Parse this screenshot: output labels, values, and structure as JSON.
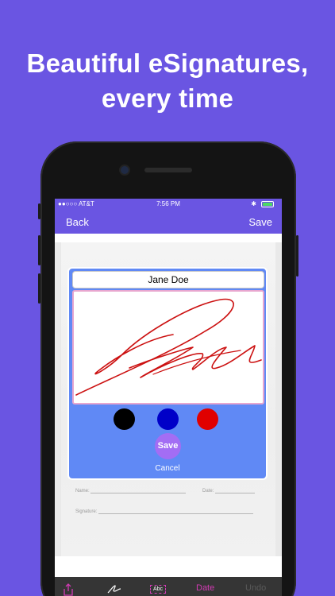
{
  "headline": {
    "line1": "Beautiful eSignatures,",
    "line2": "every time"
  },
  "status_bar": {
    "carrier": "●●○○○ AT&T",
    "time": "7:56 PM",
    "bluetooth": "✱"
  },
  "nav": {
    "back_label": "Back",
    "save_label": "Save"
  },
  "document": {
    "name_label": "Name:",
    "date_label": "Date:",
    "signature_label": "Signature:"
  },
  "signature_panel": {
    "name_value": "Jane Doe",
    "colors": [
      "#000000",
      "#0000c8",
      "#e00000"
    ],
    "signature_stroke_color": "#cc1111",
    "save_label": "Save",
    "cancel_label": "Cancel"
  },
  "toolbar": {
    "share_icon": "share-icon",
    "signature_icon": "signature-icon",
    "text_icon_label": "Abc",
    "date_label": "Date",
    "undo_label": "Undo"
  },
  "colors": {
    "background": "#6a55e2",
    "panel": "#6089f5",
    "accent_pink": "#d23bb4"
  }
}
